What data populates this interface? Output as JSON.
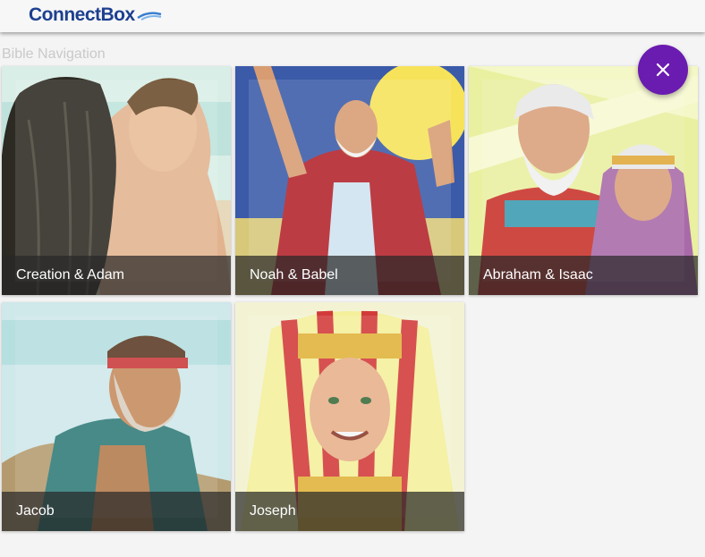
{
  "header": {
    "logo_text": "ConnectBox",
    "logo_icon": "wave-swoosh-icon"
  },
  "section": {
    "title": "Bible Navigation"
  },
  "fab": {
    "icon": "close-icon",
    "color": "#6a1bb0"
  },
  "tiles": [
    {
      "label": "Creation & Adam",
      "image": "creation-adam-illustration"
    },
    {
      "label": "Noah & Babel",
      "image": "noah-babel-illustration"
    },
    {
      "label": "Abraham & Isaac",
      "image": "abraham-isaac-illustration"
    },
    {
      "label": "Jacob",
      "image": "jacob-illustration"
    },
    {
      "label": "Joseph",
      "image": "joseph-illustration"
    }
  ]
}
